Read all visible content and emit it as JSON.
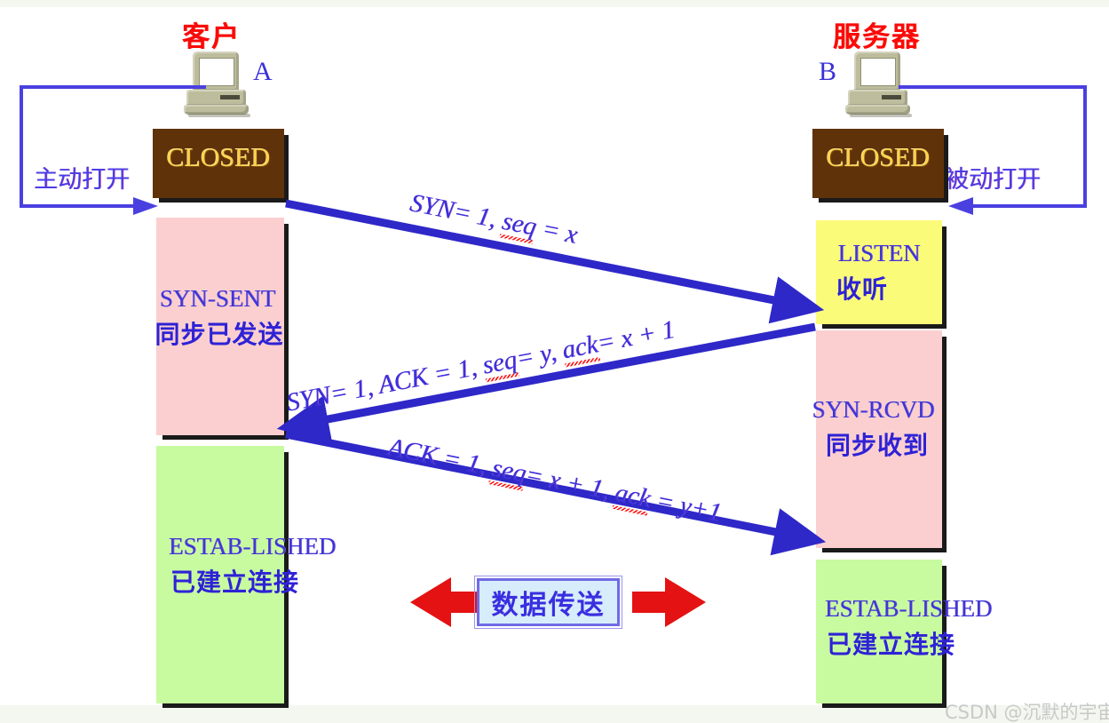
{
  "diagram": {
    "title_client": "客户",
    "title_server": "服务器",
    "host_a": "A",
    "host_b": "B",
    "active_open_label": "主动打开",
    "passive_open_label": "被动打开",
    "data_transfer_label": "数据传送",
    "watermark": "CSDN @沉默的宇宙",
    "colors": {
      "closed_box": "#5F3209",
      "closed_text": "#FFD24D",
      "pink_box": "#FBCFCF",
      "green_box": "#C8FBA0",
      "yellow_box": "#FBFB7A",
      "state_text": "#3A30DC",
      "arrow_blue": "#2F28C8",
      "title_red": "#FA0A0A",
      "data_band_red": "#E41212",
      "data_box_fill": "#D7EDFB",
      "watermark_gray": "#C9C9C9"
    }
  },
  "client_states": [
    {
      "en": "CLOSED",
      "cn": ""
    },
    {
      "en": "SYN-SENT",
      "cn": "同步已发送"
    },
    {
      "en": "ESTAB-LISHED",
      "cn": "已建立连接"
    }
  ],
  "server_states": [
    {
      "en": "CLOSED",
      "cn": ""
    },
    {
      "en": "LISTEN",
      "cn": "收听"
    },
    {
      "en": "SYN-RCVD",
      "cn": "同步收到"
    },
    {
      "en": "ESTAB-LISHED",
      "cn": "已建立连接"
    }
  ],
  "messages": [
    {
      "id": "syn",
      "direction": "client-to-server",
      "text_before_seq": "SYN= 1, ",
      "seq_word": "seq",
      "text_after_seq": " = x"
    },
    {
      "id": "syn-ack",
      "direction": "server-to-client",
      "part1": "SYN= 1, ACK = 1, ",
      "seq_word": "seq",
      "part2": "= y, ",
      "ack_word": "ack",
      "part3": "= x + 1"
    },
    {
      "id": "ack",
      "direction": "client-to-server",
      "part1": "ACK = 1, ",
      "seq_word": "seq",
      "part2": "= x + 1, ",
      "ack_word": "ack",
      "part3": " = y+1"
    }
  ]
}
